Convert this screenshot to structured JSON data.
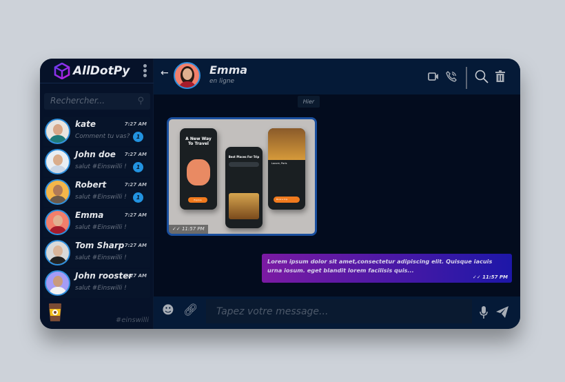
{
  "app": {
    "name": "AllDotPy",
    "hashtag": "#einswilli"
  },
  "search": {
    "placeholder": "Rechercher..."
  },
  "contacts": [
    {
      "name": "kate",
      "time": "7:27 AM",
      "message": "Comment tu vas?",
      "unread": "1",
      "avatar_bg": "#e8e4df",
      "skin": "#d6a687",
      "shirt": "#1e7a7a"
    },
    {
      "name": "John doe",
      "time": "7:27 AM",
      "message": "salut #Einswilli !",
      "unread": "1",
      "avatar_bg": "#e9eef3",
      "skin": "#d9ad8c",
      "shirt": "#c9d6e6"
    },
    {
      "name": "Robert",
      "time": "7:27 AM",
      "message": "salut #Einswilli !",
      "unread": "1",
      "avatar_bg": "#f4b64a",
      "skin": "#b07a58",
      "shirt": "#6b5a4b"
    },
    {
      "name": "Emma",
      "time": "7:27 AM",
      "message": "salut #Einswilli !",
      "avatar_bg": "#f27f6b",
      "skin": "#e0b090",
      "shirt": "#a51c2c"
    },
    {
      "name": "Tom Sharp",
      "time": "7:27 AM",
      "message": "salut #Einswilli !",
      "avatar_bg": "#d9d9d9",
      "skin": "#d9b59a",
      "shirt": "#222"
    },
    {
      "name": "John rooster",
      "time": "7:27 AM",
      "message": "salut #Einswilli !",
      "avatar_bg": "#a59cf5",
      "skin": "#c99b7d",
      "shirt": "#f2f2f2"
    }
  ],
  "chat": {
    "name": "Emma",
    "status": "en ligne",
    "date_divider": "Hier",
    "image_message": {
      "time": "11:57 PM",
      "screens": [
        "A New Way To Travel",
        "Best Places For Trip",
        "Louvre, Paris"
      ],
      "buttons": [
        "Explore",
        "Book a trip"
      ]
    },
    "text_message": {
      "text": "Lorem ipsum dolor sit amet,consectetur adipiscing elit. Quisque iacuis urna iosum. eget blandit lorem facilisis quis...",
      "time": "11:57 PM"
    }
  },
  "composer": {
    "placeholder": "Tapez votre message..."
  }
}
